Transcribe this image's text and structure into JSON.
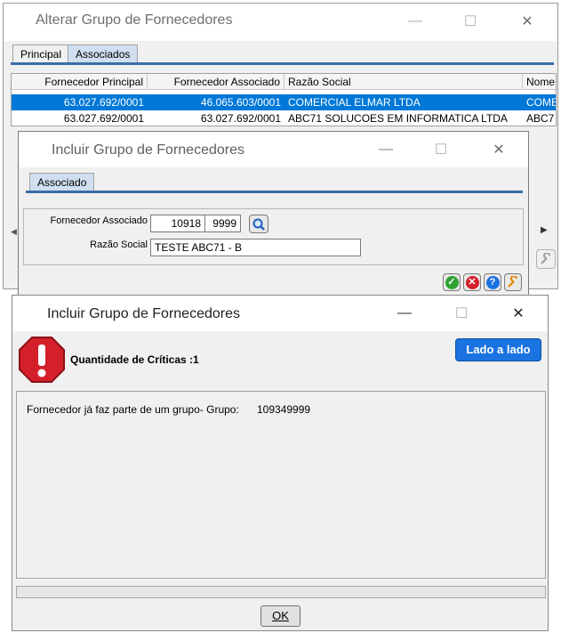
{
  "alterar": {
    "title": "Alterar Grupo de Fornecedores",
    "tabs": [
      "Principal",
      "Associados"
    ],
    "columns": [
      "Fornecedor Principal",
      "Fornecedor Associado",
      "Razão Social",
      "Nome"
    ],
    "rows": [
      [
        "63.027.692/0001",
        "46.065.603/0001",
        "COMERCIAL ELMAR LTDA",
        "COME"
      ],
      [
        "63.027.692/0001",
        "63.027.692/0001",
        "ABC71 SOLUCOES EM INFORMATICA LTDA",
        "ABC7"
      ]
    ]
  },
  "incluir_form": {
    "title": "Incluir Grupo de Fornecedores",
    "tab": "Associado",
    "fornecedor_label": "Fornecedor Associado",
    "fornecedor_code": "10918",
    "fornecedor_branch": "9999",
    "razao_label": "Razão Social",
    "razao_value": "TESTE ABC71 - B"
  },
  "criticas": {
    "title": "Incluir Grupo de Fornecedores",
    "heading": "Quantidade de Críticas :1",
    "side_button": "Lado a lado",
    "message": "Fornecedor já faz parte de um grupo- Grupo:",
    "group_value": "109349999",
    "ok_label": "OK"
  },
  "window_controls": {
    "minimize": "—",
    "maximize": "☐",
    "close": "✕"
  },
  "colors": {
    "selection": "#0078d7",
    "critical": "#d4202a",
    "primary_button": "#1a73e0"
  },
  "icons": [
    "search-icon",
    "confirm-icon",
    "cancel-icon",
    "help-icon",
    "wrench-icon",
    "critical-warning-icon"
  ]
}
